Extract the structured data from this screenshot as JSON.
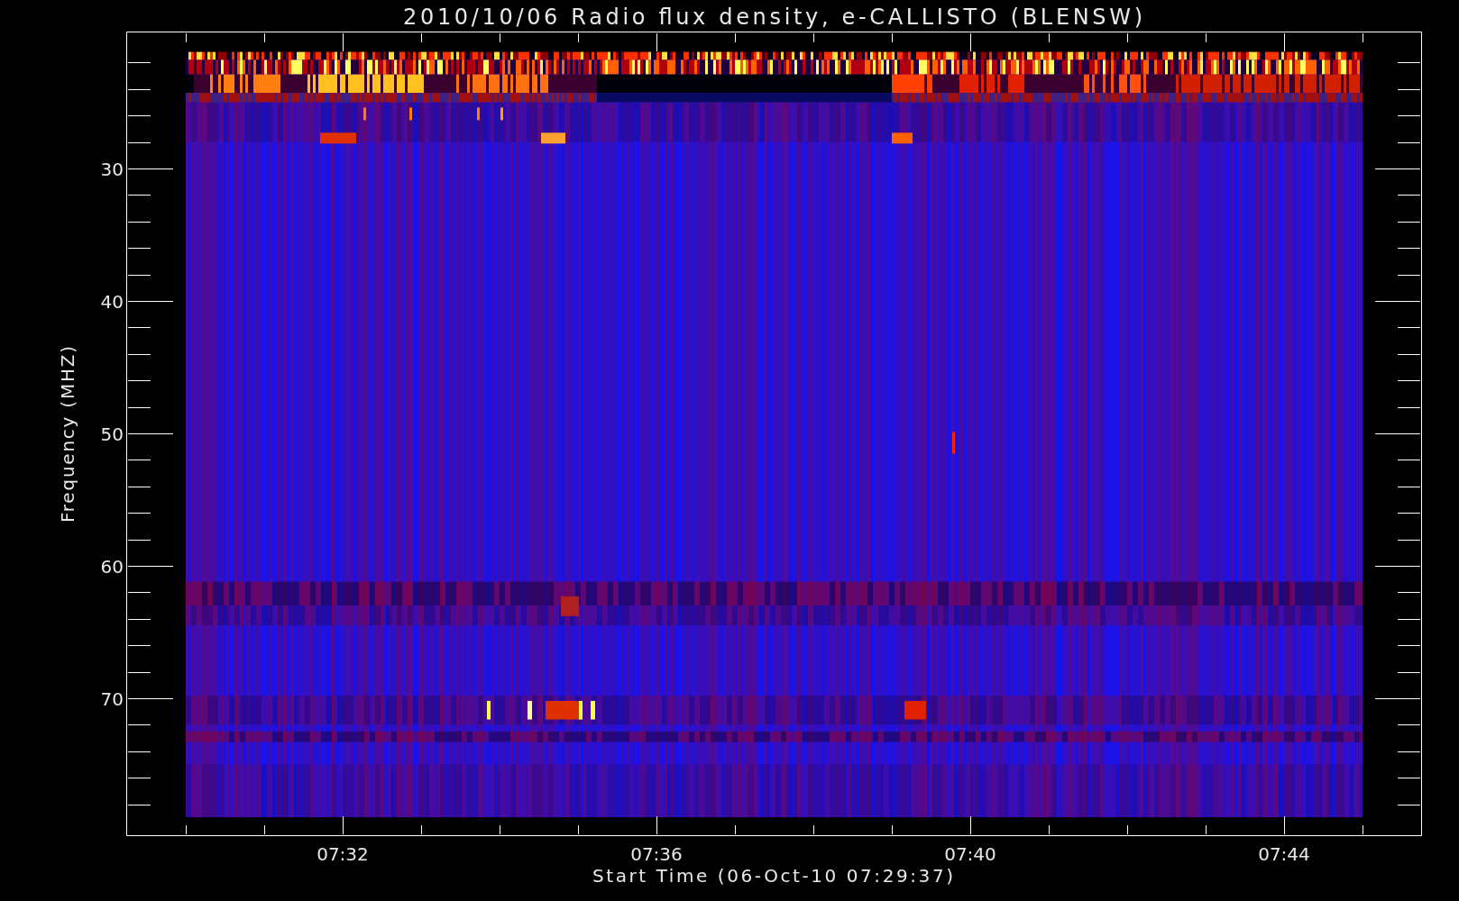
{
  "chart": {
    "title": "2010/10/06  Radio flux density, e-CALLISTO (BLENSW)",
    "xlabel": "Start Time (06-Oct-10 07:29:37)",
    "ylabel": "Frequency (MHZ)",
    "xticks": [
      {
        "label": "07:32"
      },
      {
        "label": "07:36"
      },
      {
        "label": "07:40"
      },
      {
        "label": "07:44"
      }
    ],
    "yticks": [
      {
        "label": "30"
      },
      {
        "label": "40"
      },
      {
        "label": "50"
      },
      {
        "label": "60"
      },
      {
        "label": "70"
      }
    ]
  }
}
